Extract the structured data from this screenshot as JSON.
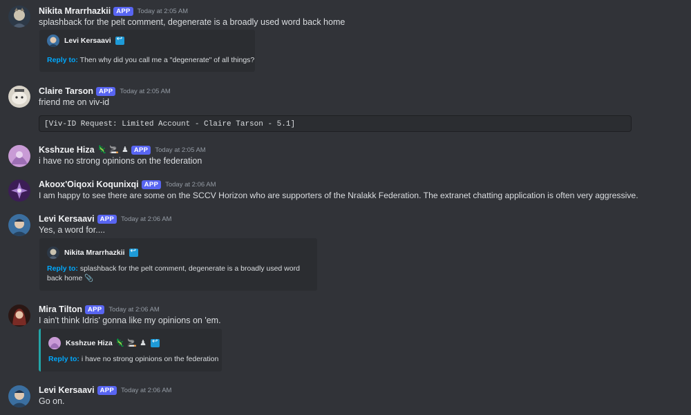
{
  "messages": [
    {
      "author": "Nikita Mrarrhazkii",
      "badge": "APP",
      "timestamp": "Today at 2:05 AM",
      "text": "splashback for the pelt comment, degenerate is a broadly used word back home",
      "embed": {
        "author": "Levi Kersaavi",
        "reply_label": "Reply to:",
        "reply_text": "Then why did you call me a \"degenerate\" of all things?"
      }
    },
    {
      "author": "Claire Tarson",
      "badge": "APP",
      "timestamp": "Today at 2:05 AM",
      "text": "friend me on viv-id",
      "code": "[Viv-ID Request: Limited Account - Claire Tarson - 5.1]"
    },
    {
      "author": "Ksshzue Hiza",
      "emojis": [
        "🦎",
        "🚬",
        "♟"
      ],
      "badge": "APP",
      "timestamp": "Today at 2:05 AM",
      "text": "i have no strong opinions on the federation"
    },
    {
      "author": "Akoox'Oiqoxi Koqunixqi",
      "badge": "APP",
      "timestamp": "Today at 2:06 AM",
      "text": "I am happy to see there are some on the SCCV Horizon who are supporters of the Nralakk Federation. The extranet chatting application is often very aggressive."
    },
    {
      "author": "Levi Kersaavi",
      "badge": "APP",
      "timestamp": "Today at 2:06 AM",
      "text": "Yes, a word for....",
      "embed": {
        "author": "Nikita Mrarrhazkii",
        "reply_label": "Reply to:",
        "reply_text_line1": "splashback for the pelt comment, degenerate is a broadly used word",
        "reply_text_line2": "back home 📎"
      }
    },
    {
      "author": "Mira Tilton",
      "badge": "APP",
      "timestamp": "Today at 2:06 AM",
      "text": "I ain't think Idris' gonna like my opinions on 'em.",
      "embed": {
        "author": "Ksshzue Hiza",
        "emojis": [
          "🦎",
          "🚬",
          "♟"
        ],
        "reply_label": "Reply to:",
        "reply_text": "i have no strong opinions on the federation"
      }
    },
    {
      "author": "Levi Kersaavi",
      "badge": "APP",
      "timestamp": "Today at 2:06 AM",
      "text": "Go on."
    }
  ],
  "icons": {
    "reply_badge": "reply-arrow-icon",
    "avatar_colors": {
      "nikita": "#3a4a5c",
      "claire": "#d8d3c8",
      "ksshzue": "#c99bd6",
      "akoox": "#5a2e7a",
      "levi": "#3b6fa0",
      "mira": "#7a2b25"
    }
  }
}
